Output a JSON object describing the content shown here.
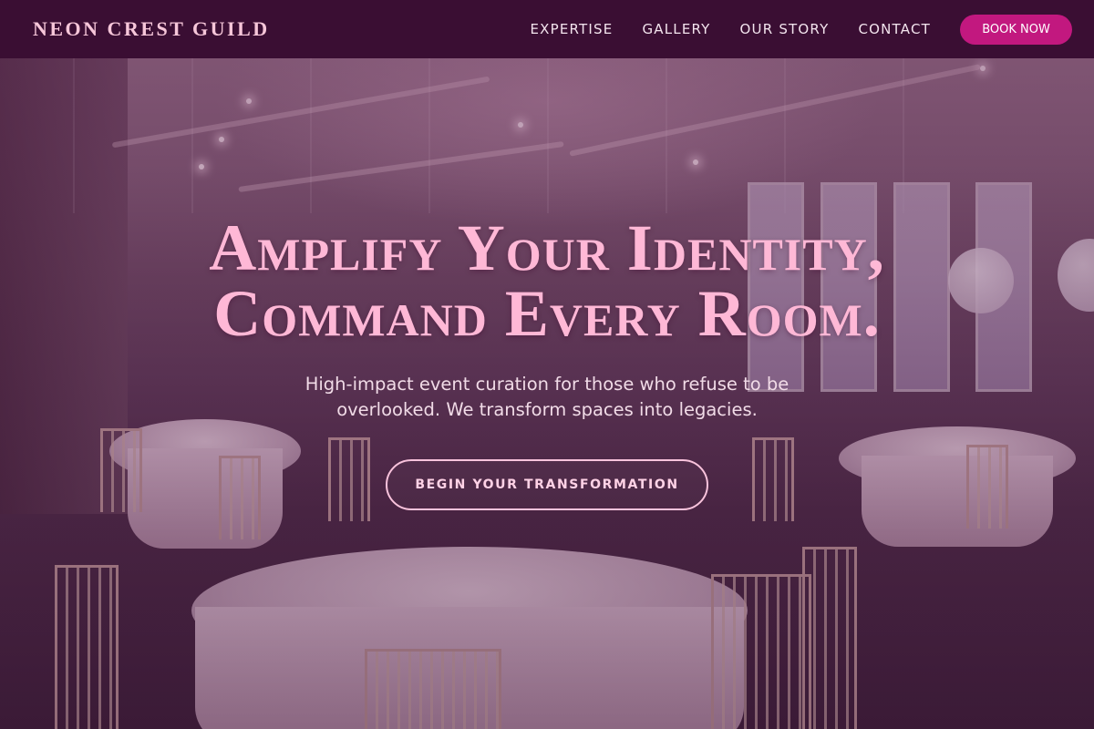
{
  "brand": {
    "name": "NEON CREST GUILD"
  },
  "nav": {
    "links": [
      "EXPERTISE",
      "GALLERY",
      "OUR STORY",
      "CONTACT"
    ],
    "cta_label": "BOOK NOW"
  },
  "hero": {
    "headline_line1": "Amplify Your Identity,",
    "headline_line2": "Command Every Room.",
    "subtitle": "High-impact event curation for those who refuse to be overlooked. We transform spaces into legacies.",
    "cta_label": "BEGIN YOUR TRANSFORMATION"
  },
  "colors": {
    "nav_background": "#3a0e33",
    "accent_pink": "#ffb8d6",
    "cta_magenta": "#c2187f"
  }
}
